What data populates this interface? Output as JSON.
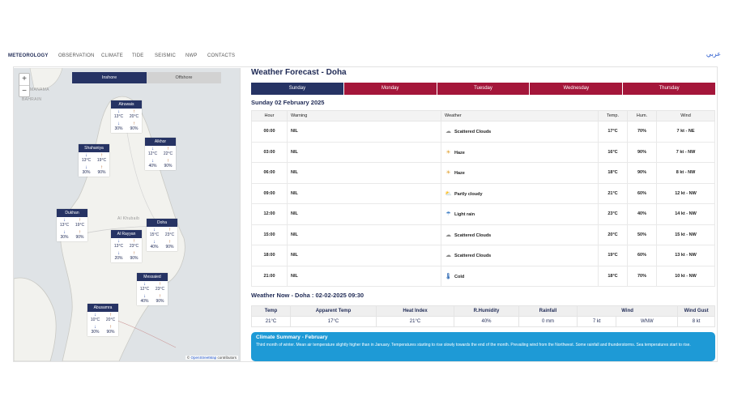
{
  "nav": {
    "items": [
      "METEOROLOGY",
      "OBSERVATION",
      "CLIMATE",
      "TIDE",
      "SEISMIC",
      "NWP",
      "CONTACTS"
    ],
    "language_link": "عربي"
  },
  "map": {
    "toggle_inshore": "Inshore",
    "toggle_offshore": "Offshore",
    "labels": {
      "manama": "MANAMA",
      "bahrain": "BAHRAIN",
      "al_khubayb": "Al Khubaib"
    },
    "attribution_prefix": "© ",
    "attribution_link": "OpenStreetMap",
    "attribution_suffix": " contributors",
    "stations": [
      {
        "name": "Alruwais",
        "min": "13°C",
        "max": "20°C",
        "hum_min": "30%",
        "hum_max": "90%"
      },
      {
        "name": "Shahaniya",
        "min": "13°C",
        "max": "19°C",
        "hum_min": "30%",
        "hum_max": "90%"
      },
      {
        "name": "Alkhor",
        "min": "12°C",
        "max": "22°C",
        "hum_min": "40%",
        "hum_max": "90%"
      },
      {
        "name": "Dukhan",
        "min": "13°C",
        "max": "19°C",
        "hum_min": "30%",
        "hum_max": "90%"
      },
      {
        "name": "Al Rayyan",
        "min": "13°C",
        "max": "23°C",
        "hum_min": "20%",
        "hum_max": "90%"
      },
      {
        "name": "Doha",
        "min": "15°C",
        "max": "23°C",
        "hum_min": "40%",
        "hum_max": "90%"
      },
      {
        "name": "Messaied",
        "min": "12°C",
        "max": "23°C",
        "hum_min": "40%",
        "hum_max": "90%"
      },
      {
        "name": "Abusamra",
        "min": "10°C",
        "max": "20°C",
        "hum_min": "30%",
        "hum_max": "90%"
      }
    ]
  },
  "forecast": {
    "title": "Weather Forecast - Doha",
    "tabs": [
      "Sunday",
      "Monday",
      "Tuesday",
      "Wednesday",
      "Thursday"
    ],
    "date": "Sunday 02 February 2025",
    "columns": [
      "Hour",
      "Warning",
      "Weather",
      "Temp.",
      "Hum.",
      "Wind"
    ],
    "rows": [
      {
        "hour": "00:00",
        "warning": "NIL",
        "icon": "cloud-icon",
        "weather": "Scattered Clouds",
        "temp": "17°C",
        "hum": "70%",
        "wind": "7 kt - NE"
      },
      {
        "hour": "03:00",
        "warning": "NIL",
        "icon": "haze-icon",
        "weather": "Haze",
        "temp": "16°C",
        "hum": "90%",
        "wind": "7 kt - NW"
      },
      {
        "hour": "06:00",
        "warning": "NIL",
        "icon": "haze-icon",
        "weather": "Haze",
        "temp": "18°C",
        "hum": "90%",
        "wind": "8 kt - NW"
      },
      {
        "hour": "09:00",
        "warning": "NIL",
        "icon": "partly-cloudy-icon",
        "weather": "Partly cloudy",
        "temp": "21°C",
        "hum": "60%",
        "wind": "12 kt - NW"
      },
      {
        "hour": "12:00",
        "warning": "NIL",
        "icon": "light-rain-icon",
        "weather": "Light rain",
        "temp": "23°C",
        "hum": "40%",
        "wind": "14 kt - NW"
      },
      {
        "hour": "15:00",
        "warning": "NIL",
        "icon": "cloud-icon",
        "weather": "Scattered Clouds",
        "temp": "20°C",
        "hum": "50%",
        "wind": "15 kt - NW"
      },
      {
        "hour": "18:00",
        "warning": "NIL",
        "icon": "cloud-icon",
        "weather": "Scattered Clouds",
        "temp": "19°C",
        "hum": "60%",
        "wind": "13 kt - NW"
      },
      {
        "hour": "21:00",
        "warning": "NIL",
        "icon": "thermometer-icon",
        "weather": "Cold",
        "temp": "18°C",
        "hum": "70%",
        "wind": "10 kt - NW"
      }
    ]
  },
  "now": {
    "title": "Weather Now - Doha : 02-02-2025 09:30",
    "columns": [
      "Temp",
      "Apparent Temp",
      "Heat Index",
      "R.Humidity",
      "Rainfall",
      "Wind",
      "Wind Gust"
    ],
    "values": {
      "temp": "21°C",
      "apparent": "17°C",
      "heat_index": "21°C",
      "humidity": "40%",
      "rainfall": "0 mm",
      "wind_speed": "7 kt",
      "wind_dir": "WNW",
      "gust": "8 kt"
    }
  },
  "climate": {
    "title": "Climate Summary - February",
    "body": "Third month of winter. Mean air temperature slightly higher than in January. Temperatures starting to rise slowly towards the end of the month. Prevailing wind from the Northwest. Some rainfall and thunderstorms. Sea temperatures start to rise."
  },
  "colors": {
    "navy": "#263364",
    "maroon": "#a4163a",
    "climate_blue": "#1e9ad6"
  }
}
